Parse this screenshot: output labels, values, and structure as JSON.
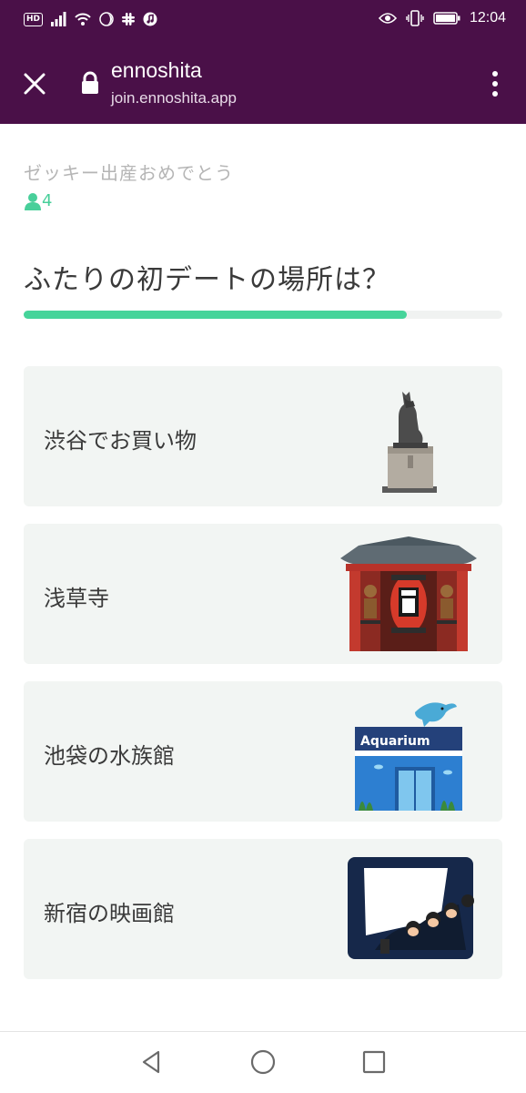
{
  "status_bar": {
    "hd_badge": "HD",
    "time": "12:04"
  },
  "app_bar": {
    "title": "ennoshita",
    "url": "join.ennoshita.app"
  },
  "quiz": {
    "subtitle": "ゼッキー出産おめでとう",
    "participant_count": "4",
    "question": "ふたりの初デートの場所は？",
    "progress_fraction": 0.8,
    "options": [
      {
        "label": "渋谷でお買い物",
        "icon": "hachiko-statue-icon"
      },
      {
        "label": "浅草寺",
        "icon": "kaminarimon-gate-icon"
      },
      {
        "label": "池袋の水族館",
        "icon": "aquarium-building-icon",
        "sign_text": "Aquarium"
      },
      {
        "label": "新宿の映画館",
        "icon": "movie-theater-icon"
      }
    ]
  },
  "colors": {
    "app_bar": "#4a1048",
    "accent": "#46d49a",
    "option_bg": "#f2f5f3"
  }
}
